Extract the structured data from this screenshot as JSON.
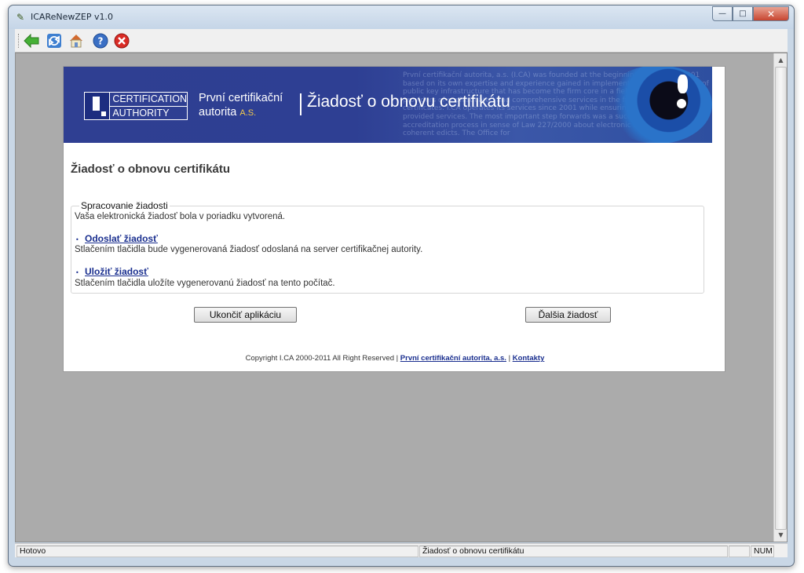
{
  "window": {
    "title": "ICAReNewZEP v1.0",
    "controls": {
      "minimize": "—",
      "maximize": "□",
      "close": "✕"
    }
  },
  "toolbar": {
    "buttons": [
      {
        "name": "back",
        "icon": "back-arrow-icon"
      },
      {
        "name": "refresh",
        "icon": "refresh-icon"
      },
      {
        "name": "home",
        "icon": "home-icon"
      },
      {
        "name": "help",
        "icon": "help-icon"
      },
      {
        "name": "stop",
        "icon": "stop-icon"
      }
    ]
  },
  "banner": {
    "logo_line1": "CERTIFICATION",
    "logo_line2": "AUTHORITY",
    "org_line1": "První certifikační",
    "org_line2": "autorita",
    "org_suffix": "A.S.",
    "title": "Žiadosť o obnovu certifikátu",
    "background_text": "První certifikační autorita, a.s. (I.CA) was founded at the beginning of the year 2001 based on its own expertise and experience gained in implementation and operation of public key infrastructure that has become the firm core in a field of commercial providers of sophisticated and comprehensive services in the field of digital certificates. I.CA operates its services since 2001 while ensuring high quality of provided services. The most important step forwards was a successful completion of accreditation process in sense of Law 227/2000 about electronic signature and coherent edicts. The Office for"
  },
  "content": {
    "heading": "Žiadosť o obnovu certifikátu",
    "legend": "Spracovanie žiadosti",
    "status_message": "Vaša elektronická žiadosť bola v poriadku vytvorená.",
    "send_link": "Odoslať žiadosť",
    "send_desc": "Stlačením tlačidla bude vygenerovaná žiadosť odoslaná na server certifikačnej autority.",
    "save_link": "Uložiť žiadosť",
    "save_desc": "Stlačením tlačidla uložíte vygenerovanú žiadosť na tento počítač.",
    "bullet": "•",
    "button_exit": "Ukončiť aplikáciu",
    "button_next": "Ďalšia žiadosť"
  },
  "footer": {
    "copyright": "Copyright I.CA 2000-2011 All Right Reserved |",
    "link_company": "První certifikační autorita, a.s.",
    "separator": "|",
    "link_contacts": "Kontakty"
  },
  "statusbar": {
    "state": "Hotovo",
    "page_title": "Žiadosť o obnovu certifikátu",
    "indicator": "NUM"
  }
}
